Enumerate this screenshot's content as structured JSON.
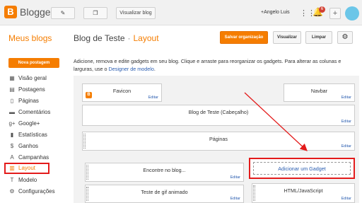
{
  "topbar": {
    "brand": "Blogger",
    "logo_letter": "B",
    "pencil_icon": "✎",
    "posts_icon": "❐",
    "view_blog": "Visualizar blog",
    "user": "+Angelo Luis",
    "apps_icon": "⋮⋮⋮",
    "bell_icon": "🔔",
    "notification_count": "6",
    "plus_icon": "+"
  },
  "header": {
    "my_blogs": "Meus blogs",
    "blog_title": "Blog de Teste",
    "separator": "·",
    "section": "Layout",
    "save": "Salvar organização",
    "preview": "Visualizar",
    "clear": "Limpar",
    "settings_icon": "⚙"
  },
  "sidebar": {
    "new_post": "Nova postagem",
    "items": [
      {
        "label": "Visão geral",
        "icon": "▦"
      },
      {
        "label": "Postagens",
        "icon": "▤"
      },
      {
        "label": "Páginas",
        "icon": "▯"
      },
      {
        "label": "Comentários",
        "icon": "▬"
      },
      {
        "label": "Google+",
        "icon": "g+"
      },
      {
        "label": "Estatísticas",
        "icon": "▮"
      },
      {
        "label": "Ganhos",
        "icon": "$"
      },
      {
        "label": "Campanhas",
        "icon": "A"
      },
      {
        "label": "Layout",
        "icon": "▥"
      },
      {
        "label": "Modelo",
        "icon": "T"
      },
      {
        "label": "Configurações",
        "icon": "⚙"
      }
    ]
  },
  "description": {
    "text": "Adicione, remova e edite gadgets em seu blog. Clique e arraste para reorganizar os gadgets. Para alterar as colunas e larguras, use o",
    "link": "Designer de modelo",
    "end": "."
  },
  "gadgets": {
    "favicon": "Favicon",
    "navbar": "Navbar",
    "header": "Blog de Teste (Cabeçalho)",
    "pages": "Páginas",
    "search": "Encontre no blog...",
    "gif_test": "Teste de gif animado",
    "html_js": "HTML/JavaScript",
    "edit": "Editar",
    "add_gadget": "Adicionar um Gadget"
  },
  "colors": {
    "accent": "#f57d00",
    "highlight": "#e31b1b",
    "link": "#2a5db0"
  }
}
